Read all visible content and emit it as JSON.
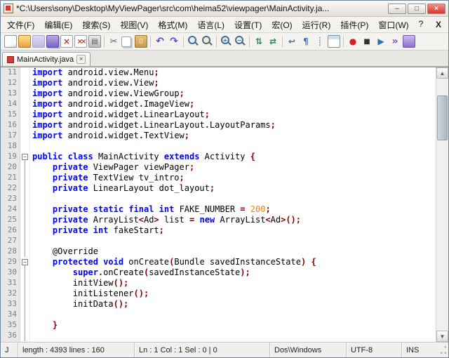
{
  "window": {
    "title": "*C:\\Users\\sony\\Desktop\\MyViewPager\\src\\com\\heima52\\viewpager\\MainActivity.ja...",
    "buttons": {
      "minimize": "–",
      "maximize": "□",
      "close": "×"
    }
  },
  "menu": {
    "items": [
      {
        "name": "file",
        "label": "文件(F)"
      },
      {
        "name": "edit",
        "label": "编辑(E)"
      },
      {
        "name": "search",
        "label": "搜索(S)"
      },
      {
        "name": "view",
        "label": "视图(V)"
      },
      {
        "name": "format",
        "label": "格式(M)"
      },
      {
        "name": "language",
        "label": "语言(L)"
      },
      {
        "name": "settings",
        "label": "设置(T)"
      },
      {
        "name": "macro",
        "label": "宏(O)"
      },
      {
        "name": "run",
        "label": "运行(R)"
      },
      {
        "name": "plugins",
        "label": "插件(P)"
      },
      {
        "name": "window",
        "label": "窗口(W)"
      },
      {
        "name": "help",
        "label": "?"
      }
    ],
    "close_label": "X"
  },
  "toolbar": {
    "items": [
      "new-file",
      "open-file",
      "save-file",
      "save-all",
      "close-file",
      "close-all",
      "print",
      "|",
      "cut",
      "copy",
      "paste",
      "|",
      "undo",
      "redo",
      "|",
      "find",
      "replace",
      "|",
      "zoom-in",
      "zoom-out",
      "|",
      "sync-v",
      "sync-h",
      "|",
      "word-wrap",
      "show-all-chars",
      "indent-guide",
      "user-dialog",
      "|",
      "record-macro",
      "stop-macro",
      "play-macro",
      "multi-play",
      "save-macro"
    ]
  },
  "tab": {
    "label": "MainActivity.java",
    "close": "×"
  },
  "editor": {
    "scroll": {
      "first_visible_line": 11,
      "total_lines": 160
    },
    "lines": [
      {
        "n": 11,
        "f": "",
        "t": [
          [
            "k",
            "import"
          ],
          [
            "p",
            " android"
          ],
          [
            "o",
            "."
          ],
          [
            "p",
            "view"
          ],
          [
            "o",
            "."
          ],
          [
            "p",
            "Menu"
          ],
          [
            "o",
            ";"
          ]
        ]
      },
      {
        "n": 12,
        "f": "",
        "t": [
          [
            "k",
            "import"
          ],
          [
            "p",
            " android"
          ],
          [
            "o",
            "."
          ],
          [
            "p",
            "view"
          ],
          [
            "o",
            "."
          ],
          [
            "p",
            "View"
          ],
          [
            "o",
            ";"
          ]
        ]
      },
      {
        "n": 13,
        "f": "",
        "t": [
          [
            "k",
            "import"
          ],
          [
            "p",
            " android"
          ],
          [
            "o",
            "."
          ],
          [
            "p",
            "view"
          ],
          [
            "o",
            "."
          ],
          [
            "p",
            "ViewGroup"
          ],
          [
            "o",
            ";"
          ]
        ]
      },
      {
        "n": 14,
        "f": "",
        "t": [
          [
            "k",
            "import"
          ],
          [
            "p",
            " android"
          ],
          [
            "o",
            "."
          ],
          [
            "p",
            "widget"
          ],
          [
            "o",
            "."
          ],
          [
            "p",
            "ImageView"
          ],
          [
            "o",
            ";"
          ]
        ]
      },
      {
        "n": 15,
        "f": "",
        "t": [
          [
            "k",
            "import"
          ],
          [
            "p",
            " android"
          ],
          [
            "o",
            "."
          ],
          [
            "p",
            "widget"
          ],
          [
            "o",
            "."
          ],
          [
            "p",
            "LinearLayout"
          ],
          [
            "o",
            ";"
          ]
        ]
      },
      {
        "n": 16,
        "f": "",
        "t": [
          [
            "k",
            "import"
          ],
          [
            "p",
            " android"
          ],
          [
            "o",
            "."
          ],
          [
            "p",
            "widget"
          ],
          [
            "o",
            "."
          ],
          [
            "p",
            "LinearLayout"
          ],
          [
            "o",
            "."
          ],
          [
            "p",
            "LayoutParams"
          ],
          [
            "o",
            ";"
          ]
        ]
      },
      {
        "n": 17,
        "f": "",
        "t": [
          [
            "k",
            "import"
          ],
          [
            "p",
            " android"
          ],
          [
            "o",
            "."
          ],
          [
            "p",
            "widget"
          ],
          [
            "o",
            "."
          ],
          [
            "p",
            "TextView"
          ],
          [
            "o",
            ";"
          ]
        ]
      },
      {
        "n": 18,
        "f": "",
        "t": []
      },
      {
        "n": 19,
        "f": "box",
        "t": [
          [
            "k",
            "public"
          ],
          [
            "p",
            " "
          ],
          [
            "k",
            "class"
          ],
          [
            "p",
            " MainActivity "
          ],
          [
            "k",
            "extends"
          ],
          [
            "p",
            " Activity "
          ],
          [
            "o",
            "{"
          ]
        ]
      },
      {
        "n": 20,
        "f": "line",
        "t": [
          [
            "p",
            "    "
          ],
          [
            "k",
            "private"
          ],
          [
            "p",
            " ViewPager viewPager"
          ],
          [
            "o",
            ";"
          ]
        ]
      },
      {
        "n": 21,
        "f": "line",
        "t": [
          [
            "p",
            "    "
          ],
          [
            "k",
            "private"
          ],
          [
            "p",
            " TextView tv_intro"
          ],
          [
            "o",
            ";"
          ]
        ]
      },
      {
        "n": 22,
        "f": "line",
        "t": [
          [
            "p",
            "    "
          ],
          [
            "k",
            "private"
          ],
          [
            "p",
            " LinearLayout dot_layout"
          ],
          [
            "o",
            ";"
          ]
        ]
      },
      {
        "n": 23,
        "f": "line",
        "t": []
      },
      {
        "n": 24,
        "f": "line",
        "t": [
          [
            "p",
            "    "
          ],
          [
            "k",
            "private"
          ],
          [
            "p",
            " "
          ],
          [
            "k",
            "static"
          ],
          [
            "p",
            " "
          ],
          [
            "k",
            "final"
          ],
          [
            "p",
            " "
          ],
          [
            "k",
            "int"
          ],
          [
            "p",
            " FAKE_NUMBER "
          ],
          [
            "o",
            "="
          ],
          [
            "p",
            " "
          ],
          [
            "n",
            "200"
          ],
          [
            "o",
            ";"
          ]
        ]
      },
      {
        "n": 25,
        "f": "line",
        "t": [
          [
            "p",
            "    "
          ],
          [
            "k",
            "private"
          ],
          [
            "p",
            " ArrayList"
          ],
          [
            "o",
            "<"
          ],
          [
            "p",
            "Ad"
          ],
          [
            "o",
            ">"
          ],
          [
            "p",
            " list "
          ],
          [
            "o",
            "="
          ],
          [
            "p",
            " "
          ],
          [
            "k",
            "new"
          ],
          [
            "p",
            " ArrayList"
          ],
          [
            "o",
            "<"
          ],
          [
            "p",
            "Ad"
          ],
          [
            "o",
            ">();"
          ]
        ]
      },
      {
        "n": 26,
        "f": "line",
        "t": [
          [
            "p",
            "    "
          ],
          [
            "k",
            "private"
          ],
          [
            "p",
            " "
          ],
          [
            "k",
            "int"
          ],
          [
            "p",
            " fakeStart"
          ],
          [
            "o",
            ";"
          ]
        ]
      },
      {
        "n": 27,
        "f": "line",
        "t": []
      },
      {
        "n": 28,
        "f": "line",
        "t": [
          [
            "p",
            "    @Override"
          ]
        ]
      },
      {
        "n": 29,
        "f": "box",
        "t": [
          [
            "p",
            "    "
          ],
          [
            "k",
            "protected"
          ],
          [
            "p",
            " "
          ],
          [
            "k",
            "void"
          ],
          [
            "p",
            " onCreate"
          ],
          [
            "o",
            "("
          ],
          [
            "p",
            "Bundle savedInstanceState"
          ],
          [
            "o",
            ")"
          ],
          [
            "p",
            " "
          ],
          [
            "o",
            "{"
          ]
        ]
      },
      {
        "n": 30,
        "f": "line",
        "t": [
          [
            "p",
            "        "
          ],
          [
            "k",
            "super"
          ],
          [
            "o",
            "."
          ],
          [
            "p",
            "onCreate"
          ],
          [
            "o",
            "("
          ],
          [
            "p",
            "savedInstanceState"
          ],
          [
            "o",
            ");"
          ]
        ]
      },
      {
        "n": 31,
        "f": "line",
        "t": [
          [
            "p",
            "        initView"
          ],
          [
            "o",
            "();"
          ]
        ]
      },
      {
        "n": 32,
        "f": "line",
        "t": [
          [
            "p",
            "        initListener"
          ],
          [
            "o",
            "();"
          ]
        ]
      },
      {
        "n": 33,
        "f": "line",
        "t": [
          [
            "p",
            "        initData"
          ],
          [
            "o",
            "();"
          ]
        ]
      },
      {
        "n": 34,
        "f": "line",
        "t": []
      },
      {
        "n": 35,
        "f": "line",
        "t": [
          [
            "p",
            "    "
          ],
          [
            "o",
            "}"
          ]
        ]
      },
      {
        "n": 36,
        "f": "line",
        "t": []
      }
    ]
  },
  "status": {
    "doctype": "J",
    "length_lines": "length : 4393    lines : 160",
    "position": "Ln : 1    Col : 1    Sel : 0 | 0",
    "eol": "Dos\\Windows",
    "encoding": "UTF-8",
    "mode": "INS"
  },
  "colors": {
    "keyword": "#0000ff",
    "operator": "#800000",
    "number": "#ff8000",
    "line_number": "#808080",
    "close_button": "#d6362b"
  }
}
